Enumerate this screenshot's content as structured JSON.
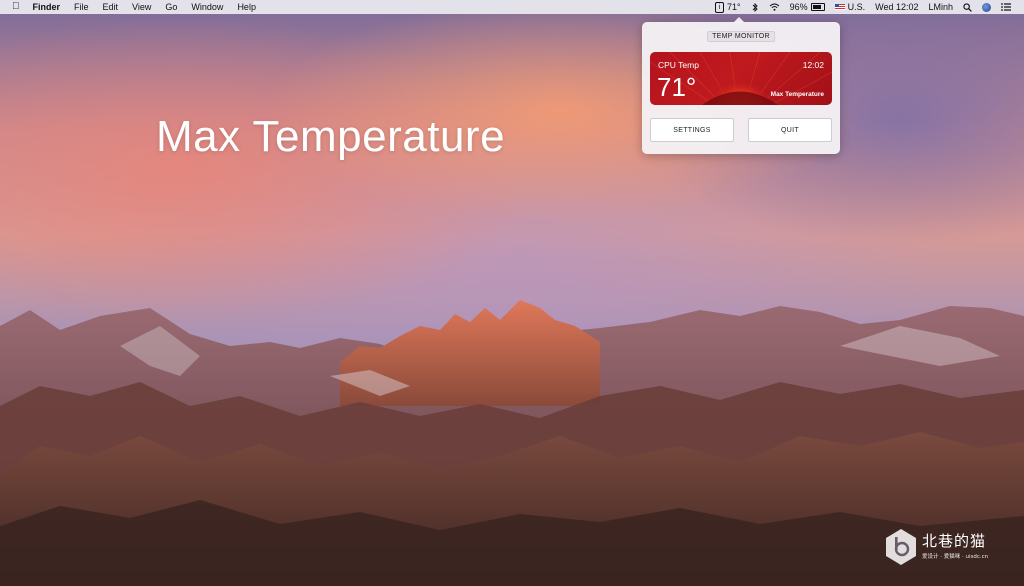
{
  "menubar": {
    "apple_icon": "apple-logo",
    "app_name": "Finder",
    "menus": [
      "File",
      "Edit",
      "View",
      "Go",
      "Window",
      "Help"
    ],
    "status": {
      "temp_icon_glyph": "i",
      "temp": "71°",
      "battery_percent": "96%",
      "input_source": "U.S.",
      "clock": "Wed 12:02",
      "user": "LMinh"
    }
  },
  "hero": {
    "title": "Max Temperature"
  },
  "popover": {
    "title": "TEMP MONITOR",
    "card": {
      "label": "CPU Temp",
      "time": "12:02",
      "value": "71°",
      "caption": "Max Temperature",
      "accent_color": "#b3121d"
    },
    "settings_label": "SETTINGS",
    "quit_label": "QUIT"
  },
  "watermark": {
    "name": "北巷的猫",
    "subtitle": "爱设计 · 爱猫咪 · uisdc.cn"
  }
}
